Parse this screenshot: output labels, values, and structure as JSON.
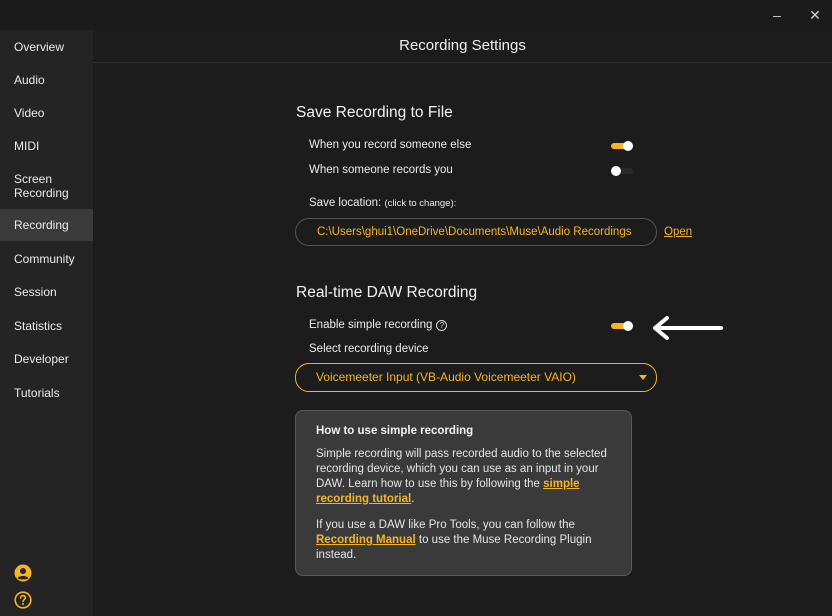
{
  "window": {
    "minimize": "–",
    "close": "✕"
  },
  "sidebar": {
    "items": [
      {
        "label": "Overview",
        "active": false
      },
      {
        "label": "Audio",
        "active": false
      },
      {
        "label": "Video",
        "active": false
      },
      {
        "label": "MIDI",
        "active": false
      },
      {
        "label": "Screen\nRecording",
        "active": false
      },
      {
        "label": "Recording",
        "active": true
      },
      {
        "label": "Community",
        "active": false
      },
      {
        "label": "Session",
        "active": false
      },
      {
        "label": "Statistics",
        "active": false
      },
      {
        "label": "Developer",
        "active": false
      },
      {
        "label": "Tutorials",
        "active": false
      }
    ],
    "bottom_icons": [
      "user-circle-icon",
      "help-circle-icon"
    ]
  },
  "main": {
    "title": "Recording Settings",
    "save_section": {
      "title": "Save Recording to File",
      "record_someone_else": {
        "label": "When you record someone else",
        "on": true
      },
      "someone_records_you": {
        "label": "When someone records you",
        "on": false
      },
      "save_location_label": "Save location:",
      "save_location_hint": "(click to change):",
      "save_location_path": "C:\\Users\\ghui1\\OneDrive\\Documents\\Muse\\Audio Recordings",
      "open_label": "Open"
    },
    "daw_section": {
      "title": "Real-time DAW Recording",
      "enable_simple": {
        "label": "Enable simple recording",
        "on": true
      },
      "help_glyph": "?",
      "select_device_label": "Select recording device",
      "selected_device": "Voicemeeter Input (VB-Audio Voicemeeter VAIO)"
    },
    "info_card": {
      "heading": "How to use simple recording",
      "p1_text": "Simple recording will pass recorded audio to the selected recording device, which you can use as an input in your DAW. Learn how to use this by following the ",
      "p1_link": "simple recording tutorial",
      "p1_end": ".",
      "p2_text": "If you use a DAW like Pro Tools, you can follow the ",
      "p2_link": "Recording Manual",
      "p2_end": " to use the Muse Recording Plugin instead."
    }
  },
  "colors": {
    "accent": "#f5b426",
    "sidebar_bg": "#242424",
    "active_bg": "#3a3a3a",
    "card_bg": "#3a3a3a"
  }
}
